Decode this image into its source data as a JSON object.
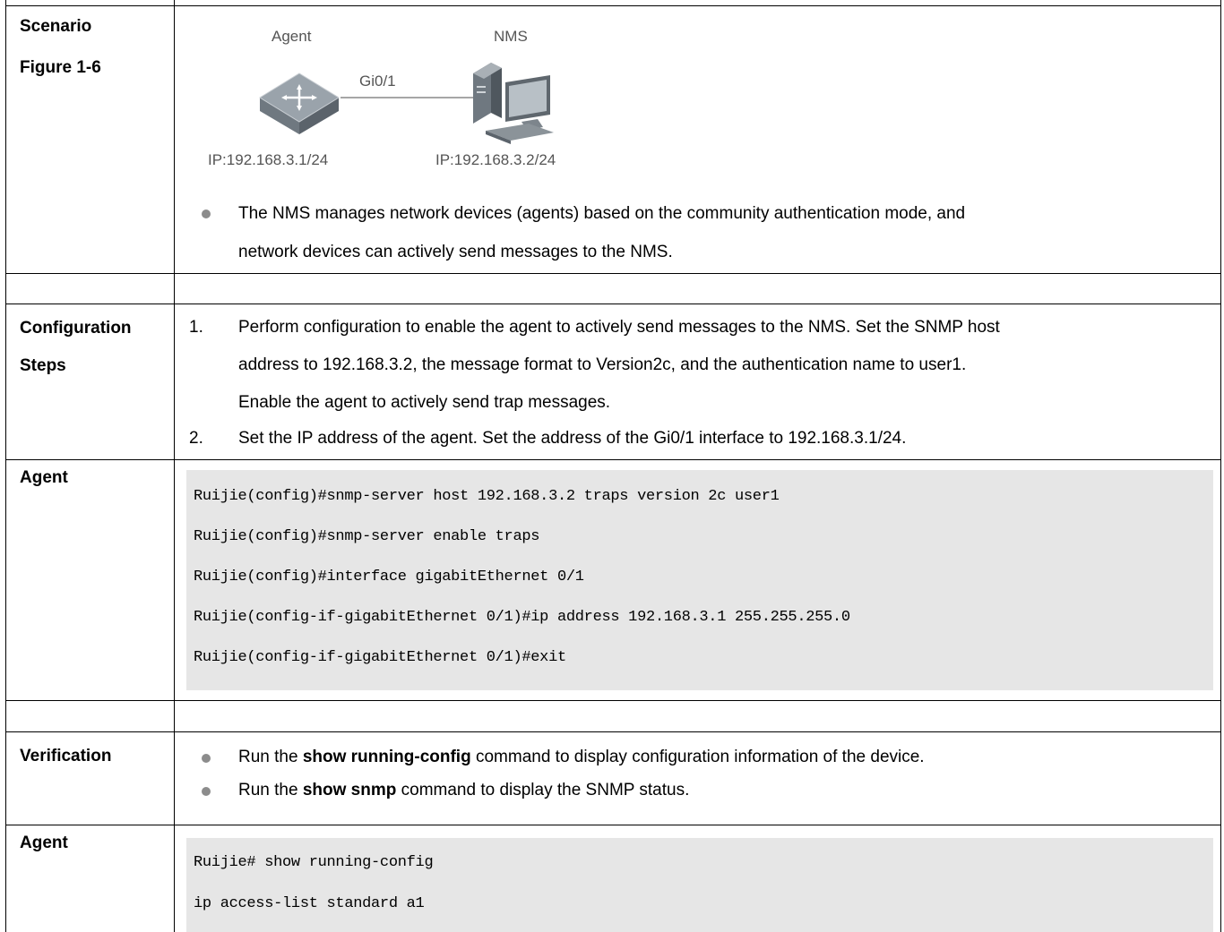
{
  "scenario": {
    "label1": "Scenario",
    "label2": "Figure 1-6",
    "figure": {
      "agent_label": "Agent",
      "nms_label": "NMS",
      "port_label": "Gi0/1",
      "agent_ip": "IP:192.168.3.1/24",
      "nms_ip": "IP:192.168.3.2/24"
    },
    "bullet_line1": "The NMS manages network devices (agents) based on the community authentication mode, and",
    "bullet_line2": "network devices can actively send messages to the NMS."
  },
  "config_steps": {
    "label1": "Configuration",
    "label2": "Steps",
    "step1_num": "1.",
    "step1_line1": "Perform configuration to enable the agent to actively send messages to the NMS. Set the SNMP host",
    "step1_line2": "address to 192.168.3.2, the message format to Version2c, and the authentication name to user1.",
    "step1_line3": "Enable the agent to actively send trap messages.",
    "step2_num": "2.",
    "step2_line1": "Set the IP address of the agent. Set the address of the Gi0/1 interface to 192.168.3.1/24."
  },
  "agent_config": {
    "label": "Agent",
    "lines": [
      "Ruijie(config)#snmp-server host 192.168.3.2 traps version 2c user1",
      "Ruijie(config)#snmp-server enable traps",
      "Ruijie(config)#interface gigabitEthernet 0/1",
      "Ruijie(config-if-gigabitEthernet 0/1)#ip address 192.168.3.1 255.255.255.0",
      "Ruijie(config-if-gigabitEthernet 0/1)#exit"
    ]
  },
  "verification": {
    "label": "Verification",
    "b1_pre": "Run the ",
    "b1_bold": "show running-config",
    "b1_post": " command to display configuration information of the device.",
    "b2_pre": "Run the ",
    "b2_bold": "show snmp",
    "b2_post": " command to display the SNMP status."
  },
  "agent_verify": {
    "label": "Agent",
    "lines": [
      "Ruijie# show running-config",
      "ip access-list standard a1"
    ]
  }
}
